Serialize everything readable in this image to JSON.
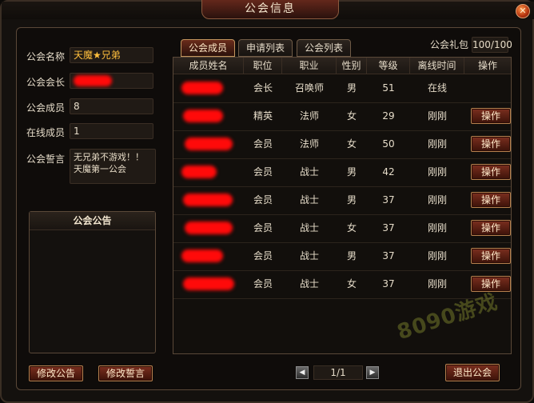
{
  "window": {
    "title": "公会信息",
    "close_symbol": "✕"
  },
  "info": {
    "name_label": "公会名称",
    "name_value": "天魔★兄弟",
    "leader_label": "公会会长",
    "members_label": "公会成员",
    "members_value": "8",
    "online_label": "在线成员",
    "online_value": "1",
    "motto_label": "公会誓言",
    "motto_value": "无兄弟不游戏！！天魔第一公会"
  },
  "notice": {
    "title": "公会公告"
  },
  "buttons": {
    "edit_notice": "修改公告",
    "edit_motto": "修改誓言",
    "quit": "退出公会"
  },
  "tabs": [
    {
      "label": "公会成员",
      "active": true
    },
    {
      "label": "申请列表",
      "active": false
    },
    {
      "label": "公会列表",
      "active": false
    }
  ],
  "gift": {
    "label": "公会礼包",
    "value": "100/100"
  },
  "table": {
    "headers": [
      "成员姓名",
      "职位",
      "职业",
      "性别",
      "等级",
      "离线时间",
      "操作"
    ],
    "rows": [
      {
        "position": "会长",
        "class": "召唤师",
        "gender": "男",
        "level": "51",
        "offline": "在线",
        "action": ""
      },
      {
        "position": "精英",
        "class": "法师",
        "gender": "女",
        "level": "29",
        "offline": "刚刚",
        "action": "操作"
      },
      {
        "position": "会员",
        "class": "法师",
        "gender": "女",
        "level": "50",
        "offline": "刚刚",
        "action": "操作"
      },
      {
        "position": "会员",
        "class": "战士",
        "gender": "男",
        "level": "42",
        "offline": "刚刚",
        "action": "操作"
      },
      {
        "position": "会员",
        "class": "战士",
        "gender": "男",
        "level": "37",
        "offline": "刚刚",
        "action": "操作"
      },
      {
        "position": "会员",
        "class": "战士",
        "gender": "女",
        "level": "37",
        "offline": "刚刚",
        "action": "操作"
      },
      {
        "position": "会员",
        "class": "战士",
        "gender": "男",
        "level": "37",
        "offline": "刚刚",
        "action": "操作"
      },
      {
        "position": "会员",
        "class": "战士",
        "gender": "女",
        "level": "37",
        "offline": "刚刚",
        "action": "操作"
      }
    ]
  },
  "pager": {
    "text": "1/1",
    "prev_symbol": "◀",
    "next_symbol": "▶"
  },
  "watermark": {
    "text": "8090游戏"
  },
  "colors": {
    "accent": "#ffbf3d",
    "redaction": "#ff0a0a",
    "button": "#7b2f1f"
  }
}
